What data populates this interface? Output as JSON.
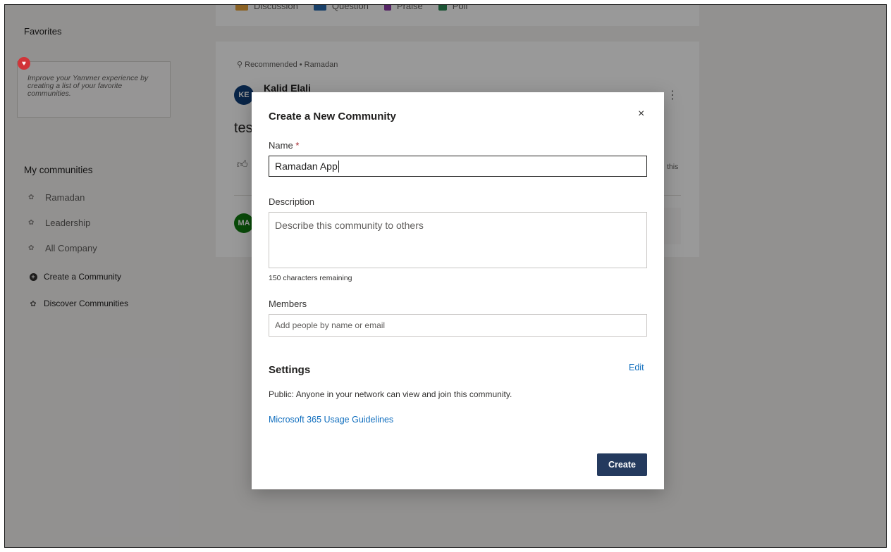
{
  "sidebar": {
    "favorites_title": "Favorites",
    "favorites_hint": "Improve your Yammer experience by creating a list of your favorite communities.",
    "my_communities_title": "My communities",
    "communities": [
      "Ramadan",
      "Leadership",
      "All Company"
    ],
    "create_community": "Create a Community",
    "discover_communities": "Discover Communities"
  },
  "publisher": {
    "types": [
      "Discussion",
      "Question",
      "Praise",
      "Poll"
    ]
  },
  "post": {
    "recommended_line": "Recommended • Ramadan",
    "author_initials": "KE",
    "author_name": "Kalid Elali",
    "text": "tes",
    "like_text": "this",
    "reply_avatar_initials": "MA"
  },
  "modal": {
    "title": "Create a New Community",
    "close_icon": "×",
    "name_label": "Name",
    "required_mark": "*",
    "name_value": "Ramadan App",
    "description_label": "Description",
    "description_placeholder": "Describe this community to others",
    "chars_remaining": "150 characters remaining",
    "members_label": "Members",
    "members_placeholder": "Add people by name or email",
    "settings_title": "Settings",
    "edit_link": "Edit",
    "settings_description": "Public: Anyone in your network can view and join this community.",
    "guidelines_link": "Microsoft 365 Usage Guidelines",
    "create_button": "Create"
  },
  "colors": {
    "primary_button": "#243a5e",
    "link": "#106ebe",
    "heart": "#d13438",
    "author_avatar": "#0f3f78",
    "reply_avatar": "#107c10"
  }
}
